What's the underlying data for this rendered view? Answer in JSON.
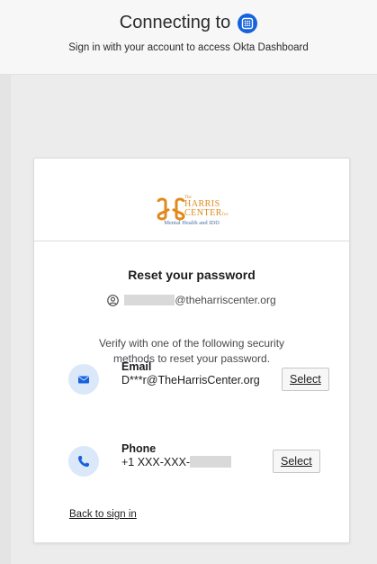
{
  "header": {
    "title": "Connecting to",
    "subtitle": "Sign in with your account to access Okta Dashboard",
    "app_icon": "okta-dashboard-icon"
  },
  "logo": {
    "the": "The",
    "line1": "HARRIS",
    "line2": "CENTER",
    "suffix": "for",
    "tagline": "Mental Health and IDD",
    "colors": {
      "mark": "#e08a1c",
      "tagline": "#4a6fa5"
    }
  },
  "form": {
    "title": "Reset your password",
    "username_suffix": "@theharriscenter.org",
    "instructions": "Verify with one of the following security methods to reset your password.",
    "methods": [
      {
        "name": "Email",
        "detail": "D***r@TheHarrisCenter.org",
        "button": "Select",
        "icon": "email-icon"
      },
      {
        "name": "Phone",
        "detail": "+1 XXX-XXX-",
        "button": "Select",
        "icon": "phone-icon"
      }
    ],
    "back_link": "Back to sign in"
  },
  "colors": {
    "accent": "#1662dd",
    "icon_bg": "#dbe8fa",
    "icon_fg": "#1662dd"
  }
}
